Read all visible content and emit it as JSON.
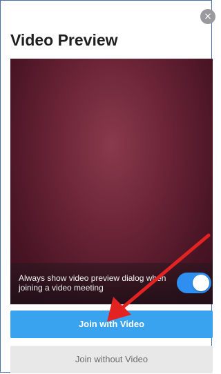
{
  "dialog": {
    "title": "Video Preview",
    "close_icon": "×",
    "setting_label": "Always show video preview dialog when joining a video meeting",
    "toggle_state": "on",
    "primary_button": "Join with Video",
    "secondary_button": "Join without Video"
  },
  "colors": {
    "accent": "#3aa3ef",
    "toggle_on": "#2f8ff0",
    "annotation_arrow": "#e32222",
    "preview_background": "#6a2436"
  },
  "icons": {
    "close": "close-icon",
    "annotation": "red-arrow-icon"
  }
}
